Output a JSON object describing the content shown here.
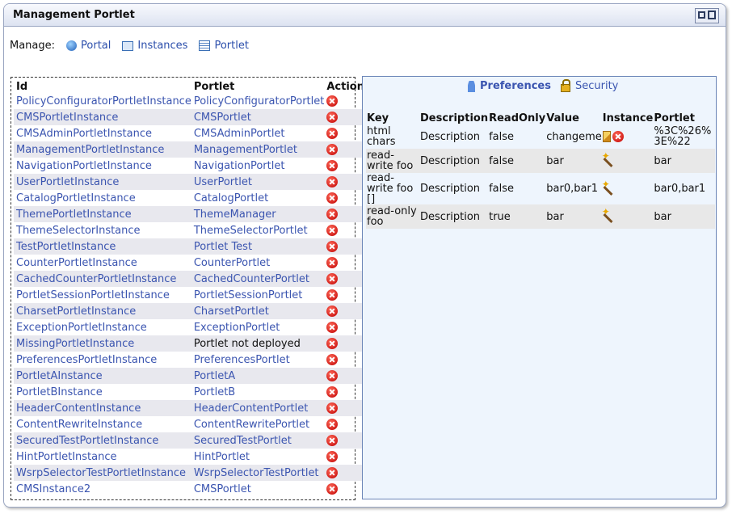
{
  "title": "Management Portlet",
  "manage": {
    "label": "Manage:",
    "links": [
      {
        "label": "Portal",
        "icon": "globe-icon"
      },
      {
        "label": "Instances",
        "icon": "instances-icon"
      },
      {
        "label": "Portlet",
        "icon": "portlet-icon"
      }
    ]
  },
  "instances": {
    "headers": {
      "id": "Id",
      "portlet": "Portlet",
      "action": "Action"
    },
    "rows": [
      {
        "id": "PolicyConfiguratorPortletInstance",
        "portlet": "PolicyConfiguratorPortlet"
      },
      {
        "id": "CMSPortletInstance",
        "portlet": "CMSPortlet"
      },
      {
        "id": "CMSAdminPortletInstance",
        "portlet": "CMSAdminPortlet"
      },
      {
        "id": "ManagementPortletInstance",
        "portlet": "ManagementPortlet"
      },
      {
        "id": "NavigationPortletInstance",
        "portlet": "NavigationPortlet"
      },
      {
        "id": "UserPortletInstance",
        "portlet": "UserPortlet"
      },
      {
        "id": "CatalogPortletInstance",
        "portlet": "CatalogPortlet"
      },
      {
        "id": "ThemePortletInstance",
        "portlet": "ThemeManager"
      },
      {
        "id": "ThemeSelectorInstance",
        "portlet": "ThemeSelectorPortlet"
      },
      {
        "id": "TestPortletInstance",
        "portlet": "Portlet Test"
      },
      {
        "id": "CounterPortletInstance",
        "portlet": "CounterPortlet"
      },
      {
        "id": "CachedCounterPortletInstance",
        "portlet": "CachedCounterPortlet"
      },
      {
        "id": "PortletSessionPortletInstance",
        "portlet": "PortletSessionPortlet"
      },
      {
        "id": "CharsetPortletInstance",
        "portlet": "CharsetPortlet"
      },
      {
        "id": "ExceptionPortletInstance",
        "portlet": "ExceptionPortlet"
      },
      {
        "id": "MissingPortletInstance",
        "portlet": "Portlet not deployed",
        "not_deployed": true
      },
      {
        "id": "PreferencesPortletInstance",
        "portlet": "PreferencesPortlet"
      },
      {
        "id": "PortletAInstance",
        "portlet": "PortletA"
      },
      {
        "id": "PortletBInstance",
        "portlet": "PortletB"
      },
      {
        "id": "HeaderContentInstance",
        "portlet": "HeaderContentPortlet"
      },
      {
        "id": "ContentRewriteInstance",
        "portlet": "ContentRewritePortlet"
      },
      {
        "id": "SecuredTestPortletInstance",
        "portlet": "SecuredTestPortlet"
      },
      {
        "id": "HintPortletInstance",
        "portlet": "HintPortlet"
      },
      {
        "id": "WsrpSelectorTestPortletInstance",
        "portlet": "WsrpSelectorTestPortlet"
      },
      {
        "id": "CMSInstance2",
        "portlet": "CMSPortlet"
      }
    ]
  },
  "details": {
    "tabs": [
      {
        "label": "Preferences",
        "icon": "person-icon",
        "active": true
      },
      {
        "label": "Security",
        "icon": "lock-icon",
        "active": false
      }
    ],
    "headers": {
      "key": "Key",
      "description": "Description",
      "readonly": "ReadOnly",
      "value": "Value",
      "instance": "Instance",
      "portlet": "Portlet"
    },
    "rows": [
      {
        "key": "html chars",
        "description": "Description",
        "readonly": "false",
        "value": "changeme",
        "instance_icons": [
          "edit-icon",
          "delete-icon"
        ],
        "portlet": "%3C%26%3E%22"
      },
      {
        "key": "read-write foo",
        "description": "Description",
        "readonly": "false",
        "value": "bar",
        "instance_icons": [
          "wand-icon"
        ],
        "portlet": "bar"
      },
      {
        "key": "read-write foo []",
        "description": "Description",
        "readonly": "false",
        "value": "bar0,bar1",
        "instance_icons": [
          "wand-icon"
        ],
        "portlet": "bar0,bar1"
      },
      {
        "key": "read-only foo",
        "description": "Description",
        "readonly": "true",
        "value": "bar",
        "instance_icons": [
          "wand-icon"
        ],
        "portlet": "bar"
      }
    ]
  }
}
